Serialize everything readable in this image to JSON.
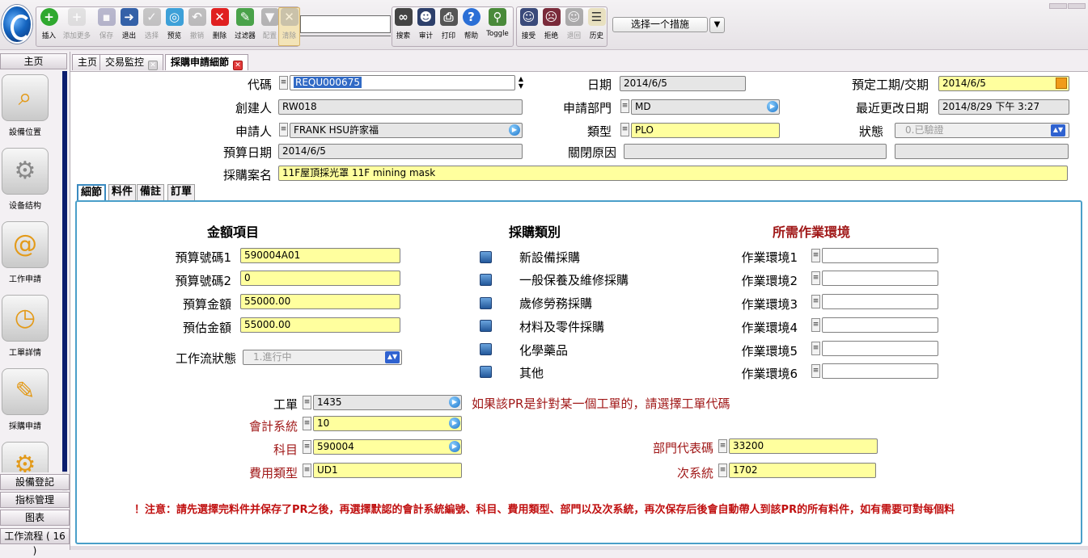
{
  "toolbar": {
    "group1": [
      {
        "label": "插入",
        "icon": "plus-icon",
        "disabled": false
      },
      {
        "label": "添加更多",
        "icon": "add-more-icon",
        "disabled": true
      },
      {
        "label": "保存",
        "icon": "save-icon",
        "disabled": true
      },
      {
        "label": "退出",
        "icon": "exit-icon",
        "disabled": false
      },
      {
        "label": "选择",
        "icon": "check-icon",
        "disabled": true
      },
      {
        "label": "预览",
        "icon": "preview-icon",
        "disabled": false
      },
      {
        "label": "撤销",
        "icon": "undo-icon",
        "disabled": true
      },
      {
        "label": "删除",
        "icon": "delete-icon",
        "disabled": false
      },
      {
        "label": "过滤器",
        "icon": "filter-icon",
        "disabled": false
      },
      {
        "label": "配置",
        "icon": "funnel-icon",
        "disabled": true
      },
      {
        "label": "清除",
        "icon": "clear-filter-icon",
        "disabled": true
      }
    ],
    "group2": [
      {
        "label": "搜索",
        "icon": "binoculars-icon"
      },
      {
        "label": "审计",
        "icon": "audit-icon"
      },
      {
        "label": "打印",
        "icon": "printer-icon"
      },
      {
        "label": "帮助",
        "icon": "help-icon"
      },
      {
        "label": "Toggle",
        "icon": "toggle-icon"
      }
    ],
    "group3": [
      {
        "label": "接受",
        "icon": "accept-user-icon"
      },
      {
        "label": "拒绝",
        "icon": "reject-user-icon"
      },
      {
        "label": "退回",
        "icon": "return-user-icon"
      },
      {
        "label": "历史",
        "icon": "history-icon"
      }
    ],
    "search_value": "",
    "action_select": "选择一个措施"
  },
  "sidebar": {
    "header": "主页",
    "tiles": [
      {
        "label": "設備位置",
        "icon": "location-search-icon"
      },
      {
        "label": "设备结构",
        "icon": "machine-structure-icon"
      },
      {
        "label": "工作申請",
        "icon": "work-request-icon"
      },
      {
        "label": "工單詳情",
        "icon": "work-order-icon"
      },
      {
        "label": "採購申請",
        "icon": "purchase-request-icon"
      },
      {
        "label": "",
        "icon": "gear-location-icon"
      }
    ],
    "bottom": [
      "設備登記",
      "指标管理",
      "图表",
      "工作流程 ( 16 )"
    ]
  },
  "tabs": [
    {
      "label": "主页",
      "closable": false
    },
    {
      "label": "交易監控",
      "closable": true
    },
    {
      "label": "採購申請細節",
      "closable": true,
      "active": true
    }
  ],
  "header_form": {
    "code": {
      "label": "代碼",
      "value": "REQU000675"
    },
    "creator": {
      "label": "創建人",
      "value": "RW018"
    },
    "applicant": {
      "label": "申請人",
      "value": "FRANK HSU許家福"
    },
    "budget_date": {
      "label": "預算日期",
      "value": "2014/6/5"
    },
    "case_name": {
      "label": "採購案名",
      "value": "11F屋頂採光罩 11F mining mask"
    },
    "date": {
      "label": "日期",
      "value": "2014/6/5"
    },
    "dept": {
      "label": "申請部門",
      "value": "MD"
    },
    "type": {
      "label": "類型",
      "value": "PLO"
    },
    "close_reason": {
      "label": "關閉原因",
      "value": "",
      "value2": ""
    },
    "due": {
      "label": "預定工期/交期",
      "value": "2014/6/5"
    },
    "last_modified": {
      "label": "最近更改日期",
      "value": "2014/8/29 下午 3:27"
    },
    "status": {
      "label": "狀態",
      "value": "0.已驗證"
    }
  },
  "sub_tabs": [
    "細節",
    "料件",
    "備註",
    "訂單"
  ],
  "detail": {
    "amount_head": "金額項目",
    "budget_no1": {
      "label": "預算號碼1",
      "value": "590004A01"
    },
    "budget_no2": {
      "label": "預算號碼2",
      "value": "0"
    },
    "budget_amt": {
      "label": "預算金額",
      "value": "55000.00"
    },
    "est_amt": {
      "label": "預估金額",
      "value": "55000.00"
    },
    "workflow": {
      "label": "工作流狀態",
      "value": "1.進行中"
    },
    "category_head": "採購類別",
    "categories": [
      "新設備採購",
      "一般保養及維修採購",
      "歲修勞務採購",
      "材料及零件採購",
      "化學藥品",
      "其他"
    ],
    "env_head": "所需作業環境",
    "envs": [
      "作業環境1",
      "作業環境2",
      "作業環境3",
      "作業環境4",
      "作業環境5",
      "作業環境6"
    ],
    "work_order": {
      "label": "工單",
      "value": "1435",
      "hint": "如果該PR是針對某一個工單的，請選擇工單代碼"
    },
    "acct_system": {
      "label": "會計系統",
      "value": "10"
    },
    "subject": {
      "label": "科目",
      "value": "590004"
    },
    "fee_type": {
      "label": "費用類型",
      "value": "UD1"
    },
    "dept_code": {
      "label": "部門代表碼",
      "value": "33200"
    },
    "sub_system": {
      "label": "次系統",
      "value": "1702"
    },
    "note": "！注意：請先選擇完料件并保存了PR之後，再選擇默認的會計系統編號、科目、費用類型、部門以及次系統，再次保存后後會自動帶人到該PR的所有料件，如有需要可對每個料"
  }
}
